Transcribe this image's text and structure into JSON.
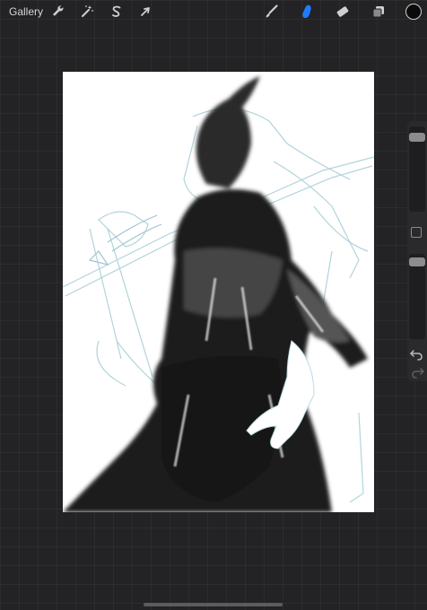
{
  "toolbar": {
    "gallery_label": "Gallery",
    "left_tools": [
      {
        "name": "actions",
        "icon": "wrench-icon"
      },
      {
        "name": "adjustments",
        "icon": "magic-wand-icon"
      },
      {
        "name": "selection",
        "icon": "selection-s-icon"
      },
      {
        "name": "transform",
        "icon": "arrow-cursor-icon"
      }
    ],
    "right_tools": [
      {
        "name": "brush",
        "icon": "brush-icon",
        "active": false
      },
      {
        "name": "smudge",
        "icon": "smudge-finger-icon",
        "active": true
      },
      {
        "name": "eraser",
        "icon": "eraser-icon",
        "active": false
      },
      {
        "name": "layers",
        "icon": "layers-icon",
        "active": false
      }
    ],
    "current_color": "#0a0a0a",
    "active_tool_color": "#1f7bff"
  },
  "sidebar": {
    "brush_size_level": 0.08,
    "opacity_level": 0.05,
    "undo_icon": "undo-arrow-icon",
    "redo_icon": "redo-arrow-icon"
  }
}
